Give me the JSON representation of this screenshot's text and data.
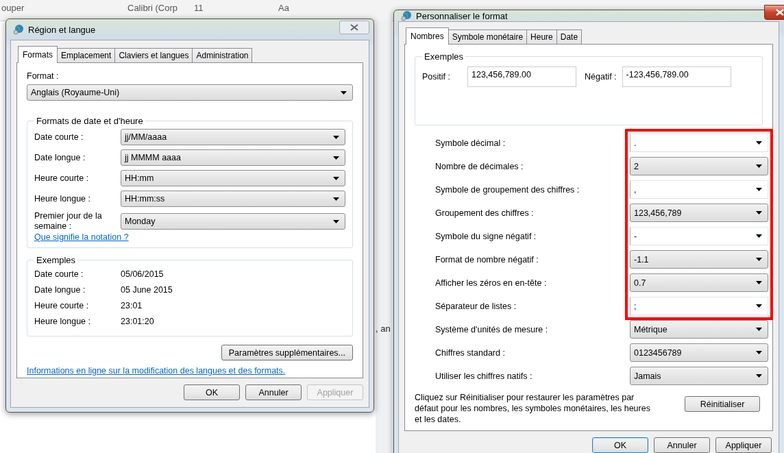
{
  "background_window": {
    "clipboard_label": "ouper",
    "font_name": "Calibri (Corp",
    "font_size": "11",
    "change_case": "Aa",
    "document_text": ", an"
  },
  "region_dialog": {
    "title": "Région et langue",
    "tabs": [
      {
        "label": "Formats",
        "selected": true
      },
      {
        "label": "Emplacement",
        "selected": false
      },
      {
        "label": "Claviers et langues",
        "selected": false
      },
      {
        "label": "Administration",
        "selected": false
      }
    ],
    "format_label": "Format :",
    "format_value": "Anglais (Royaume-Uni)",
    "date_time_group": {
      "title": "Formats de date et d'heure",
      "rows": [
        {
          "label": "Date courte :",
          "value": "jj/MM/aaaa"
        },
        {
          "label": "Date longue :",
          "value": "jj MMMM aaaa"
        },
        {
          "label": "Heure courte :",
          "value": "HH:mm"
        },
        {
          "label": "Heure longue :",
          "value": "HH:mm:ss"
        },
        {
          "label": "Premier jour de la semaine :",
          "value": "Monday"
        }
      ]
    },
    "notation_link": "Que signifie la notation ?",
    "examples": {
      "title": "Exemples",
      "rows": [
        {
          "label": "Date courte :",
          "value": "05/06/2015"
        },
        {
          "label": "Date longue :",
          "value": "05 June 2015"
        },
        {
          "label": "Heure courte :",
          "value": "23:01"
        },
        {
          "label": "Heure longue :",
          "value": "23:01:20"
        }
      ]
    },
    "more_settings_button": "Paramètres supplémentaires...",
    "info_link": "Informations en ligne sur la modification des langues et des formats.",
    "buttons": [
      {
        "label": "OK",
        "disabled": false
      },
      {
        "label": "Annuler",
        "disabled": false
      },
      {
        "label": "Appliquer",
        "disabled": true
      }
    ]
  },
  "customize_dialog": {
    "title": "Personnaliser le format",
    "tabs": [
      {
        "label": "Nombres",
        "selected": true
      },
      {
        "label": "Symbole monétaire",
        "selected": false
      },
      {
        "label": "Heure",
        "selected": false
      },
      {
        "label": "Date",
        "selected": false
      }
    ],
    "examples": {
      "title": "Exemples",
      "positive_label": "Positif :",
      "positive_value": "123,456,789.00",
      "negative_label": "Négatif :",
      "negative_value": "-123,456,789.00"
    },
    "settings": [
      {
        "label": "Symbole décimal :",
        "value": ".",
        "kind": "editable",
        "highlighted": true
      },
      {
        "label": "Nombre de décimales :",
        "value": "2",
        "kind": "list",
        "highlighted": true
      },
      {
        "label": "Symbole de groupement des chiffres :",
        "value": ",",
        "kind": "editable",
        "highlighted": true
      },
      {
        "label": "Groupement des chiffres :",
        "value": "123,456,789",
        "kind": "list",
        "highlighted": true
      },
      {
        "label": "Symbole du signe négatif :",
        "value": "-",
        "kind": "editable",
        "highlighted": true
      },
      {
        "label": "Format de nombre négatif :",
        "value": "-1.1",
        "kind": "list",
        "highlighted": true
      },
      {
        "label": "Afficher les zéros en en-tête :",
        "value": "0.7",
        "kind": "list",
        "highlighted": true
      },
      {
        "label": "Séparateur de listes :",
        "value": ";",
        "kind": "editable",
        "highlighted": true
      },
      {
        "label": "Système d'unités de mesure :",
        "value": "Métrique",
        "kind": "list",
        "highlighted": false
      },
      {
        "label": "Chiffres standard :",
        "value": "0123456789",
        "kind": "list",
        "highlighted": false
      },
      {
        "label": "Utiliser les chiffres natifs :",
        "value": "Jamais",
        "kind": "list",
        "highlighted": false
      }
    ],
    "reset_note": "Cliquez sur Réinitialiser pour restaurer les paramètres par défaut pour les nombres, les symboles monétaires, les heures et les dates.",
    "reset_button": "Réinitialiser",
    "buttons": [
      {
        "label": "OK",
        "disabled": false,
        "default": true
      },
      {
        "label": "Annuler",
        "disabled": false,
        "default": false
      },
      {
        "label": "Appliquer",
        "disabled": false,
        "default": false
      }
    ]
  }
}
